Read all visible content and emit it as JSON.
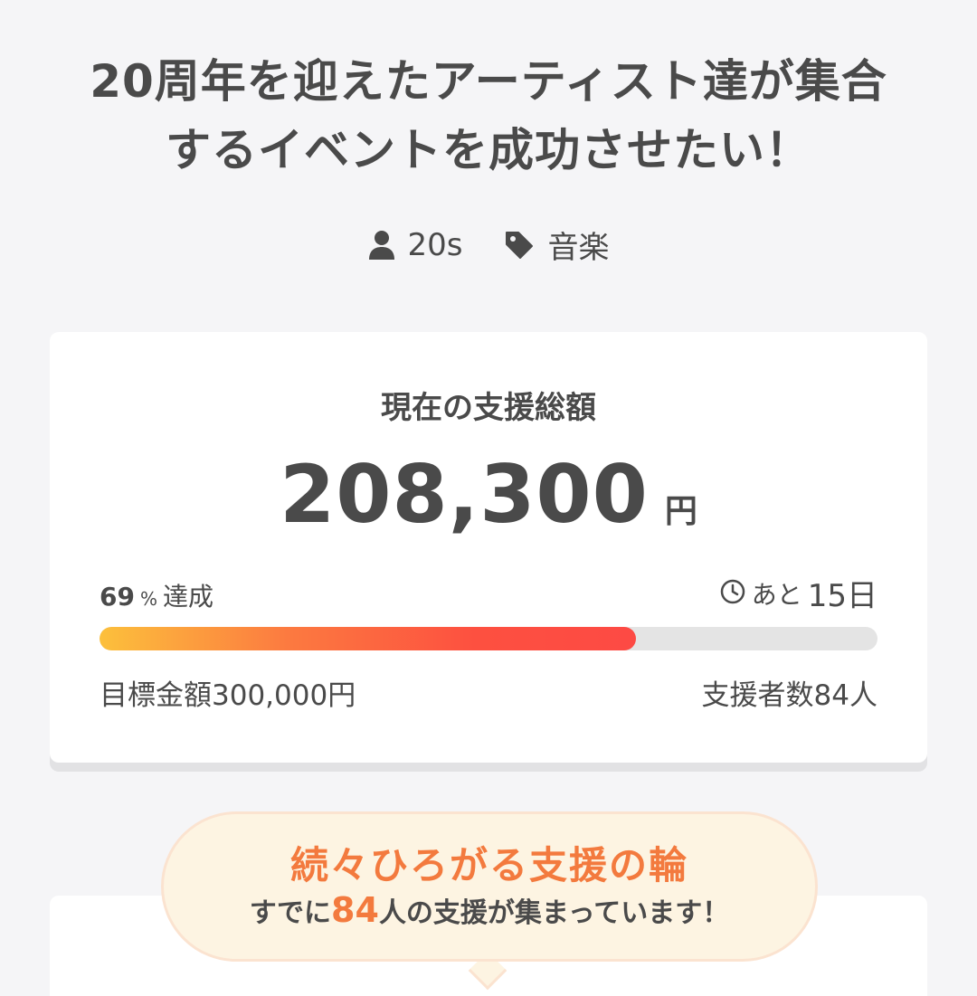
{
  "project": {
    "title_line1": "20周年を迎えたアーティスト達が集合",
    "title_line2": "するイベントを成功させたい！",
    "owner": "20s",
    "owner_icon": "user-icon",
    "category": "音楽",
    "category_icon": "tag-icon"
  },
  "funding": {
    "label": "現在の支援総額",
    "amount": "208,300",
    "unit": "円",
    "percent": "69",
    "percent_sign": "%",
    "percent_text": "達成",
    "progress_fraction": 0.69,
    "remaining_prefix": "あと",
    "remaining_days": "15日",
    "clock_icon": "clock-icon",
    "goal": "目標金額300,000円",
    "supporters": "支援者数84人"
  },
  "banner": {
    "title": "続々ひろがる支援の輪",
    "sub_prefix": "すでに",
    "sub_count": "84",
    "sub_suffix": "人の支援が集まっています！"
  },
  "colors": {
    "accent": "#f37a3e",
    "text": "#4a4a4a",
    "bar_start": "#fcc03c",
    "bar_end": "#fd4a44",
    "bubble_bg": "#fdf4e2"
  }
}
